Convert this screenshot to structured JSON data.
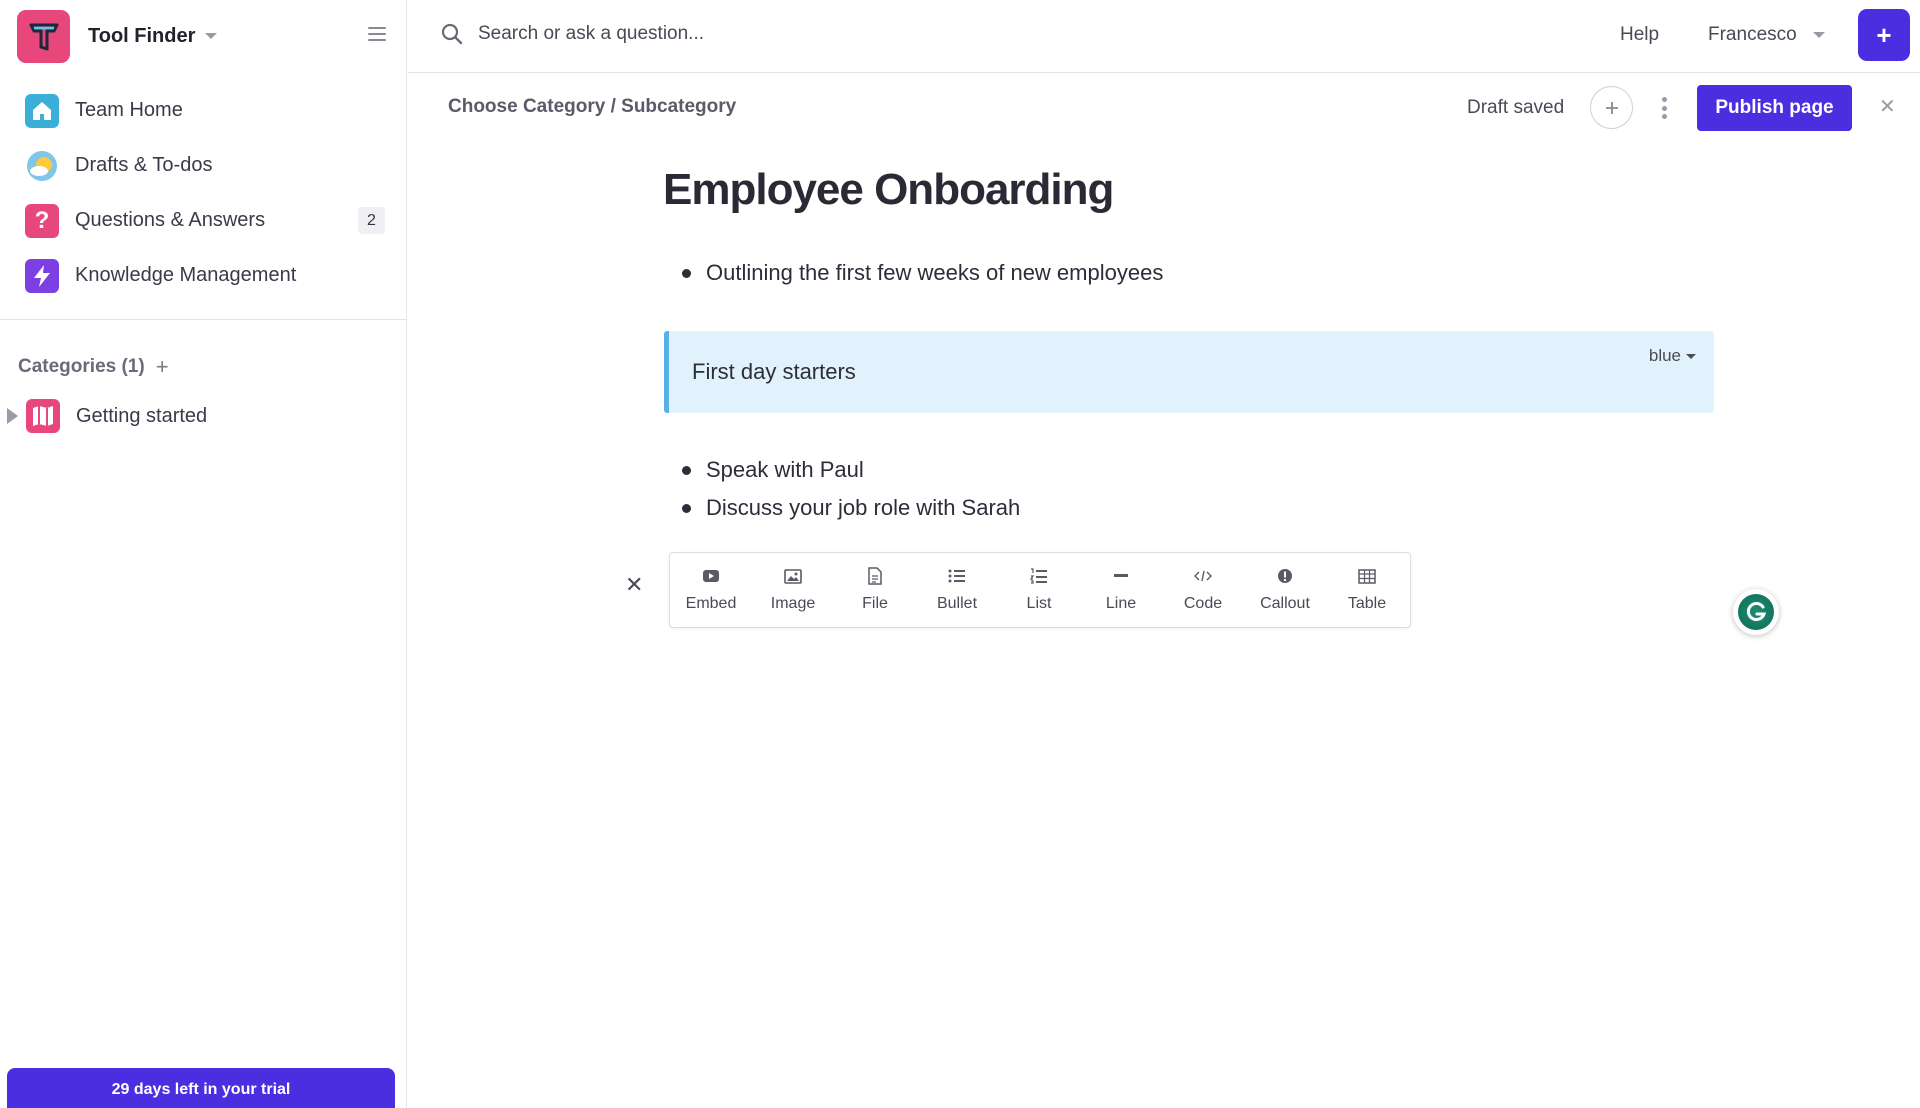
{
  "sidebar": {
    "workspace_name": "Tool Finder",
    "nav": [
      {
        "label": "Team Home",
        "icon": "home-icon"
      },
      {
        "label": "Drafts & To-dos",
        "icon": "drafts-icon"
      },
      {
        "label": "Questions & Answers",
        "icon": "question-icon",
        "badge": "2"
      },
      {
        "label": "Knowledge Management",
        "icon": "lightning-icon"
      }
    ],
    "categories_title": "Categories (1)",
    "categories": [
      {
        "label": "Getting started",
        "icon": "map-icon"
      }
    ],
    "trial_text": "29 days left in your trial"
  },
  "topbar": {
    "search_placeholder": "Search or ask a question...",
    "help_label": "Help",
    "user_name": "Francesco",
    "new_button": "+"
  },
  "page": {
    "breadcrumb": "Choose Category / Subcategory",
    "draft_status": "Draft saved",
    "publish_label": "Publish page",
    "title": "Employee Onboarding",
    "intro_bullets": [
      "Outlining the first few weeks of new employees"
    ],
    "callout": {
      "text": "First day starters",
      "color_label": "blue"
    },
    "bullets": [
      "Speak with Paul",
      "Discuss your job role with Sarah"
    ]
  },
  "insert_toolbar": [
    {
      "label": "Embed",
      "icon": "youtube-icon"
    },
    {
      "label": "Image",
      "icon": "image-icon"
    },
    {
      "label": "File",
      "icon": "file-icon"
    },
    {
      "label": "Bullet",
      "icon": "bullet-list-icon"
    },
    {
      "label": "List",
      "icon": "numbered-list-icon"
    },
    {
      "label": "Line",
      "icon": "line-icon"
    },
    {
      "label": "Code",
      "icon": "code-icon"
    },
    {
      "label": "Callout",
      "icon": "info-icon"
    },
    {
      "label": "Table",
      "icon": "table-icon"
    }
  ],
  "colors": {
    "accent": "#4b2ee0",
    "brand_pink": "#e8477b",
    "callout_bg": "#e2f2fc",
    "callout_border": "#57b1e6"
  }
}
